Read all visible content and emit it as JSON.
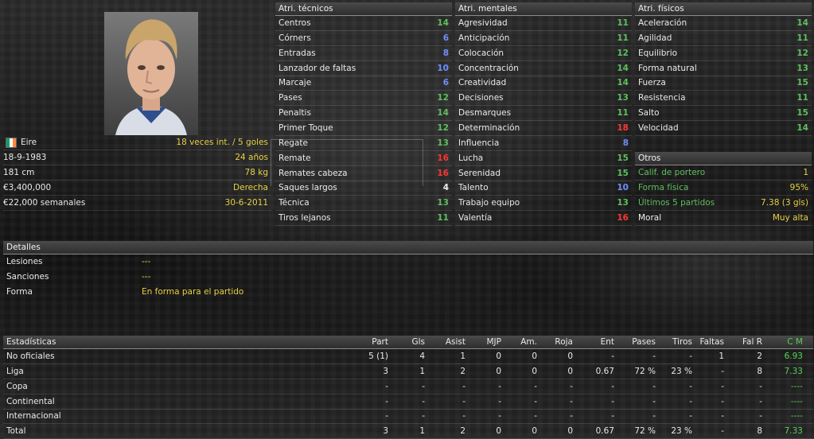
{
  "player": {
    "nationality": "Eire",
    "caps": "18 veces int. / 5 goles",
    "dob": "18-9-1983",
    "age": "24 años",
    "height": "181 cm",
    "weight": "78 kg",
    "value": "€3,400,000",
    "foot": "Derecha",
    "wage": "€22,000 semanales",
    "contract": "30-6-2011"
  },
  "tecnicos": {
    "title": "Atri. técnicos",
    "items": [
      {
        "label": "Centros",
        "value": "14",
        "color": "green"
      },
      {
        "label": "Córners",
        "value": "6",
        "color": "blue"
      },
      {
        "label": "Entradas",
        "value": "8",
        "color": "blue"
      },
      {
        "label": "Lanzador de faltas",
        "value": "10",
        "color": "blue"
      },
      {
        "label": "Marcaje",
        "value": "6",
        "color": "blue"
      },
      {
        "label": "Pases",
        "value": "12",
        "color": "green"
      },
      {
        "label": "Penaltis",
        "value": "14",
        "color": "green"
      },
      {
        "label": "Primer Toque",
        "value": "12",
        "color": "green"
      },
      {
        "label": "Regate",
        "value": "13",
        "color": "green"
      },
      {
        "label": "Remate",
        "value": "16",
        "color": "red"
      },
      {
        "label": "Remates cabeza",
        "value": "16",
        "color": "red"
      },
      {
        "label": "Saques largos",
        "value": "4",
        "color": "white"
      },
      {
        "label": "Técnica",
        "value": "13",
        "color": "green"
      },
      {
        "label": "Tiros lejanos",
        "value": "11",
        "color": "green"
      }
    ]
  },
  "mentales": {
    "title": "Atri. mentales",
    "items": [
      {
        "label": "Agresividad",
        "value": "11",
        "color": "green"
      },
      {
        "label": "Anticipación",
        "value": "11",
        "color": "green"
      },
      {
        "label": "Colocación",
        "value": "12",
        "color": "green"
      },
      {
        "label": "Concentración",
        "value": "14",
        "color": "green"
      },
      {
        "label": "Creatividad",
        "value": "14",
        "color": "green"
      },
      {
        "label": "Decisiones",
        "value": "13",
        "color": "green"
      },
      {
        "label": "Desmarques",
        "value": "11",
        "color": "green"
      },
      {
        "label": "Determinación",
        "value": "18",
        "color": "red"
      },
      {
        "label": "Influencia",
        "value": "8",
        "color": "blue"
      },
      {
        "label": "Lucha",
        "value": "15",
        "color": "green"
      },
      {
        "label": "Serenidad",
        "value": "15",
        "color": "green"
      },
      {
        "label": "Talento",
        "value": "10",
        "color": "blue"
      },
      {
        "label": "Trabajo equipo",
        "value": "13",
        "color": "green"
      },
      {
        "label": "Valentía",
        "value": "16",
        "color": "red"
      }
    ]
  },
  "fisicos": {
    "title": "Atri. físicos",
    "items": [
      {
        "label": "Aceleración",
        "value": "14",
        "color": "green"
      },
      {
        "label": "Agilidad",
        "value": "11",
        "color": "green"
      },
      {
        "label": "Equilibrio",
        "value": "12",
        "color": "green"
      },
      {
        "label": "Forma natural",
        "value": "13",
        "color": "green"
      },
      {
        "label": "Fuerza",
        "value": "15",
        "color": "green"
      },
      {
        "label": "Resistencia",
        "value": "11",
        "color": "green"
      },
      {
        "label": "Salto",
        "value": "15",
        "color": "green"
      },
      {
        "label": "Velocidad",
        "value": "14",
        "color": "green"
      }
    ]
  },
  "otros": {
    "title": "Otros",
    "items": [
      {
        "label": "Calif. de portero",
        "value": "1"
      },
      {
        "label": "Forma física",
        "value": "95%"
      },
      {
        "label": "Últimos 5 partidos",
        "value": "7.38 (3 gls)"
      },
      {
        "label": "Moral",
        "value": "Muy alta"
      }
    ]
  },
  "detalles": {
    "title": "Detalles",
    "items": [
      {
        "label": "Lesiones",
        "value": "---"
      },
      {
        "label": "Sanciones",
        "value": "---"
      },
      {
        "label": "Forma",
        "value": "En forma para el partido"
      }
    ]
  },
  "estadisticas": {
    "title": "Estadísticas",
    "columns": [
      "Part",
      "Gls",
      "Asist",
      "MJP",
      "Am.",
      "Roja",
      "Ent",
      "Pases",
      "Tiros",
      "Faltas",
      "Fal R",
      "C M"
    ],
    "rows": [
      {
        "label": "No oficiales",
        "cells": [
          "5 (1)",
          "4",
          "1",
          "0",
          "0",
          "0",
          "-",
          "-",
          "-",
          "1",
          "2",
          "6.93"
        ]
      },
      {
        "label": "Liga",
        "cells": [
          "3",
          "1",
          "2",
          "0",
          "0",
          "0",
          "0.67",
          "72 %",
          "23 %",
          "-",
          "8",
          "7.33"
        ]
      },
      {
        "label": "Copa",
        "cells": [
          "-",
          "-",
          "-",
          "-",
          "-",
          "-",
          "-",
          "-",
          "-",
          "-",
          "-",
          "----"
        ]
      },
      {
        "label": "Continental",
        "cells": [
          "-",
          "-",
          "-",
          "-",
          "-",
          "-",
          "-",
          "-",
          "-",
          "-",
          "-",
          "----"
        ]
      },
      {
        "label": "Internacional",
        "cells": [
          "-",
          "-",
          "-",
          "-",
          "-",
          "-",
          "-",
          "-",
          "-",
          "-",
          "-",
          "----"
        ]
      },
      {
        "label": "Total",
        "cells": [
          "3",
          "1",
          "2",
          "0",
          "0",
          "0",
          "0.67",
          "72 %",
          "23 %",
          "-",
          "8",
          "7.33"
        ]
      }
    ]
  },
  "colors": {
    "green": "#5fbf5f",
    "blue": "#6f8fff",
    "red": "#ff3535",
    "yellow": "#e8d044",
    "white": "#efefef"
  }
}
